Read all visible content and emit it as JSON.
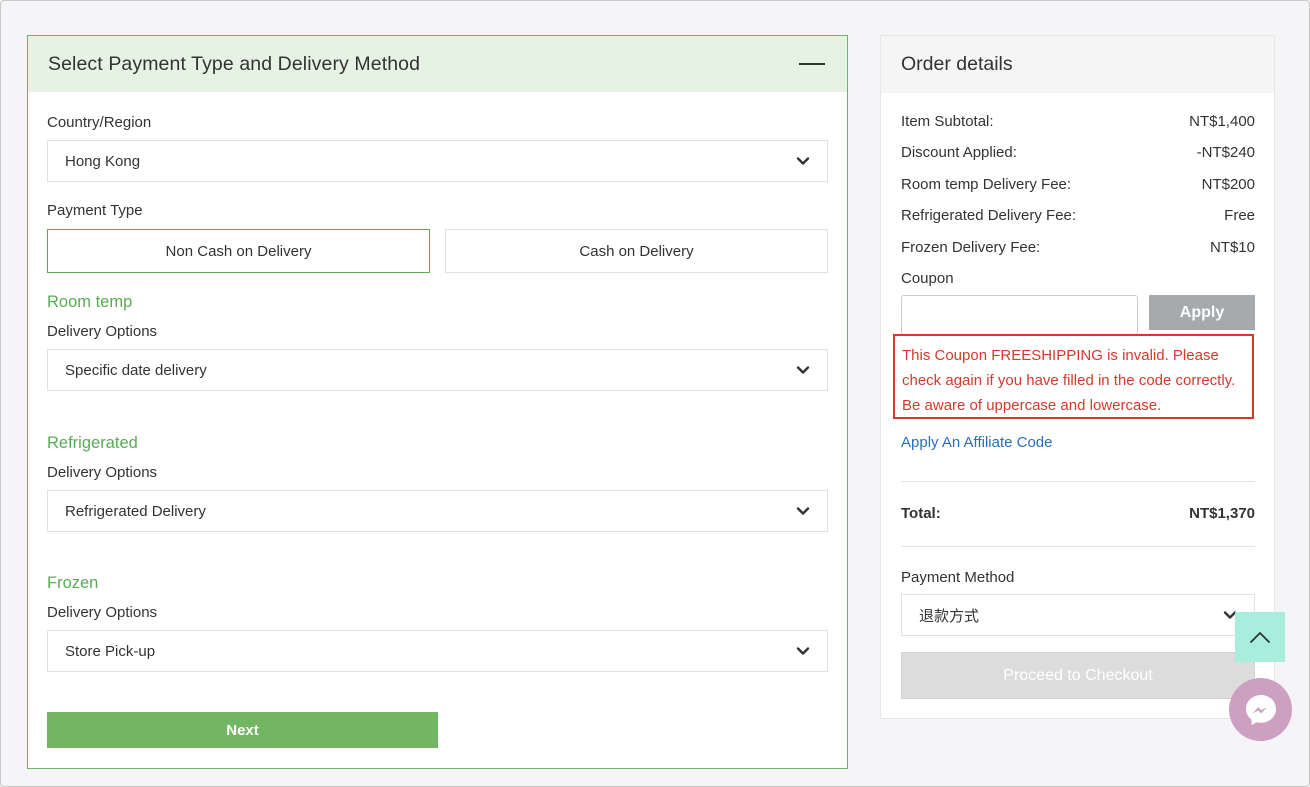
{
  "left": {
    "title": "Select Payment Type and Delivery Method",
    "country_label": "Country/Region",
    "country_value": "Hong Kong",
    "payment_type_label": "Payment Type",
    "payment_options": [
      "Non Cash on Delivery",
      "Cash on Delivery"
    ],
    "sections": [
      {
        "title": "Room temp",
        "label": "Delivery Options",
        "value": "Specific date delivery"
      },
      {
        "title": "Refrigerated",
        "label": "Delivery Options",
        "value": "Refrigerated Delivery"
      },
      {
        "title": "Frozen",
        "label": "Delivery Options",
        "value": "Store Pick-up"
      }
    ],
    "next_label": "Next"
  },
  "right": {
    "title": "Order details",
    "rows": [
      {
        "label": "Item Subtotal:",
        "value": "NT$1,400"
      },
      {
        "label": "Discount Applied:",
        "value": "-NT$240"
      },
      {
        "label": "Room temp Delivery Fee:",
        "value": "NT$200"
      },
      {
        "label": "Refrigerated Delivery Fee:",
        "value": "Free"
      },
      {
        "label": "Frozen Delivery Fee:",
        "value": "NT$10"
      }
    ],
    "coupon_label": "Coupon",
    "coupon_value": "",
    "apply_label": "Apply",
    "error_message": "This Coupon FREESHIPPING is invalid. Please check again if you have filled in the code correctly. Be aware of uppercase and lowercase.",
    "affiliate_link": "Apply An Affiliate Code",
    "total_label": "Total:",
    "total_value": "NT$1,370",
    "payment_method_label": "Payment Method",
    "payment_method_value": "退款方式",
    "checkout_label": "Proceed to Checkout"
  },
  "colors": {
    "accent_green": "#5aac55",
    "header_green_bg": "#e6f2e3",
    "next_button": "#72b663",
    "error_red": "#d33a2c",
    "link_blue": "#2a6ebb",
    "scroll_top_bg": "#a9eddc",
    "messenger_bg": "#cd9fc0"
  },
  "icons": {
    "collapse": "minus-icon",
    "dropdown": "chevron-down-icon",
    "scroll_top": "chevron-up-icon",
    "chat": "messenger-icon"
  }
}
